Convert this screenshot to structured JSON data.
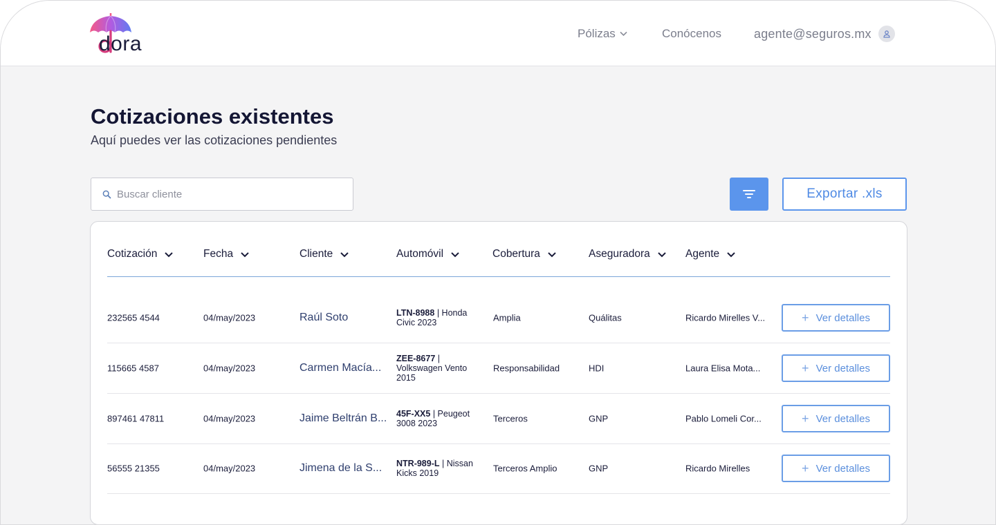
{
  "brand": {
    "name": "dora"
  },
  "nav": {
    "polizas": "Pólizas",
    "conocenos": "Conócenos",
    "user_email": "agente@seguros.mx"
  },
  "page": {
    "title": "Cotizaciones existentes",
    "subtitle": "Aquí puedes ver las cotizaciones pendientes"
  },
  "toolbar": {
    "search_placeholder": "Buscar cliente",
    "export_label": "Exportar .xls"
  },
  "table": {
    "columns": [
      "Cotización",
      "Fecha",
      "Cliente",
      "Automóvil",
      "Cobertura",
      "Aseguradora",
      "Agente"
    ],
    "detail_label": "Ver detalles",
    "rows": [
      {
        "cotizacion": "232565 4544",
        "fecha": "04/may/2023",
        "cliente": "Raúl Soto",
        "placa": "LTN-8988",
        "auto": " | Honda Civic 2023",
        "cobertura": "Amplia",
        "aseguradora": "Quálitas",
        "agente": "Ricardo Mirelles V..."
      },
      {
        "cotizacion": "115665 4587",
        "fecha": "04/may/2023",
        "cliente": "Carmen Macía...",
        "placa": "ZEE-8677",
        "auto": " | Volkswagen Vento 2015",
        "cobertura": "Responsabilidad",
        "aseguradora": "HDI",
        "agente": "Laura Elisa Mota..."
      },
      {
        "cotizacion": "897461 47811",
        "fecha": "04/may/2023",
        "cliente": "Jaime Beltrán B...",
        "placa": "45F-XX5",
        "auto": " | Peugeot 3008 2023",
        "cobertura": "Terceros",
        "aseguradora": "GNP",
        "agente": "Pablo Lomeli Cor..."
      },
      {
        "cotizacion": "56555 21355",
        "fecha": "04/may/2023",
        "cliente": "Jimena de la S...",
        "placa": "NTR-989-L",
        "auto": " | Nissan Kicks 2019",
        "cobertura": "Terceros Amplio",
        "aseguradora": "GNP",
        "agente": "Ricardo Mirelles"
      }
    ]
  },
  "colors": {
    "accent": "#5b95ec",
    "page_bg": "#f4f4f5",
    "logo_gradient": [
      "#f45a86",
      "#b25be0",
      "#5f7cf0"
    ]
  }
}
